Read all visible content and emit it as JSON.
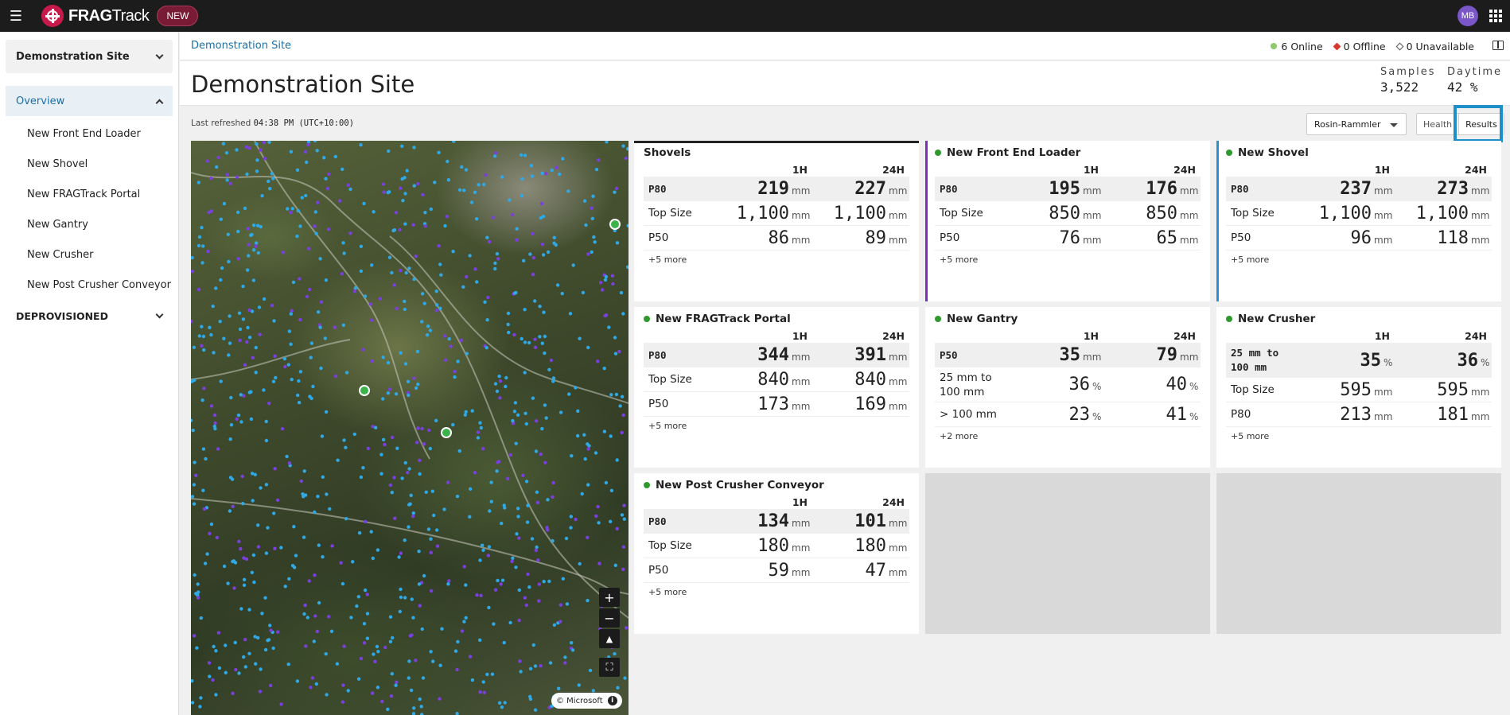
{
  "header": {
    "logo_bold": "FRAG",
    "logo_light": "Track",
    "new_badge": "NEW",
    "avatar": "MB"
  },
  "sidebar": {
    "site": "Demonstration Site",
    "overview": "Overview",
    "items": [
      "New Front End Loader",
      "New Shovel",
      "New FRAGTrack Portal",
      "New Gantry",
      "New Crusher",
      "New Post Crusher Conveyor"
    ],
    "deprovisioned": "DEPROVISIONED"
  },
  "breadcrumb": "Demonstration Site",
  "status": {
    "online": "6 Online",
    "offline": "0 Offline",
    "unavailable": "0 Unavailable"
  },
  "page_title": "Demonstration Site",
  "kpis": {
    "samples_label": "Samples",
    "samples_value": "3,522",
    "daytime_label": "Daytime",
    "daytime_value": "42 %"
  },
  "refresh": {
    "label": "Last refreshed",
    "time": "04:38 PM (UTC+10:00)"
  },
  "controls": {
    "model": "Rosin-Rammler",
    "health": "Health",
    "results": "Results"
  },
  "map": {
    "attribution": "© Microsoft",
    "zoom_in": "+",
    "zoom_out": "−"
  },
  "col_1h": "1H",
  "col_24h": "24H",
  "cards": [
    {
      "title": "Shovels",
      "rows": [
        {
          "label": "P80",
          "v1": "219",
          "u1": "mm",
          "v2": "227",
          "u2": "mm"
        },
        {
          "label": "Top Size",
          "v1": "1,100",
          "u1": "mm",
          "v2": "1,100",
          "u2": "mm"
        },
        {
          "label": "P50",
          "v1": "86",
          "u1": "mm",
          "v2": "89",
          "u2": "mm"
        }
      ],
      "more": "+5 more"
    },
    {
      "title": "New Front End Loader",
      "rows": [
        {
          "label": "P80",
          "v1": "195",
          "u1": "mm",
          "v2": "176",
          "u2": "mm"
        },
        {
          "label": "Top Size",
          "v1": "850",
          "u1": "mm",
          "v2": "850",
          "u2": "mm"
        },
        {
          "label": "P50",
          "v1": "76",
          "u1": "mm",
          "v2": "65",
          "u2": "mm"
        }
      ],
      "more": "+5 more"
    },
    {
      "title": "New Shovel",
      "rows": [
        {
          "label": "P80",
          "v1": "237",
          "u1": "mm",
          "v2": "273",
          "u2": "mm"
        },
        {
          "label": "Top Size",
          "v1": "1,100",
          "u1": "mm",
          "v2": "1,100",
          "u2": "mm"
        },
        {
          "label": "P50",
          "v1": "96",
          "u1": "mm",
          "v2": "118",
          "u2": "mm"
        }
      ],
      "more": "+5 more"
    },
    {
      "title": "New FRAGTrack Portal",
      "rows": [
        {
          "label": "P80",
          "v1": "344",
          "u1": "mm",
          "v2": "391",
          "u2": "mm"
        },
        {
          "label": "Top Size",
          "v1": "840",
          "u1": "mm",
          "v2": "840",
          "u2": "mm"
        },
        {
          "label": "P50",
          "v1": "173",
          "u1": "mm",
          "v2": "169",
          "u2": "mm"
        }
      ],
      "more": "+5 more"
    },
    {
      "title": "New Gantry",
      "rows": [
        {
          "label": "P50",
          "v1": "35",
          "u1": "mm",
          "v2": "79",
          "u2": "mm"
        },
        {
          "label": "25 mm to 100 mm",
          "v1": "36",
          "u1": "%",
          "v2": "40",
          "u2": "%"
        },
        {
          "label": "> 100 mm",
          "v1": "23",
          "u1": "%",
          "v2": "41",
          "u2": "%"
        }
      ],
      "more": "+2 more"
    },
    {
      "title": "New Crusher",
      "rows": [
        {
          "label": "25 mm to 100 mm",
          "v1": "35",
          "u1": "%",
          "v2": "36",
          "u2": "%"
        },
        {
          "label": "Top Size",
          "v1": "595",
          "u1": "mm",
          "v2": "595",
          "u2": "mm"
        },
        {
          "label": "P80",
          "v1": "213",
          "u1": "mm",
          "v2": "181",
          "u2": "mm"
        }
      ],
      "more": "+5 more"
    },
    {
      "title": "New Post Crusher Conveyor",
      "rows": [
        {
          "label": "P80",
          "v1": "134",
          "u1": "mm",
          "v2": "101",
          "u2": "mm"
        },
        {
          "label": "Top Size",
          "v1": "180",
          "u1": "mm",
          "v2": "180",
          "u2": "mm"
        },
        {
          "label": "P50",
          "v1": "59",
          "u1": "mm",
          "v2": "47",
          "u2": "mm"
        }
      ],
      "more": "+5 more"
    }
  ],
  "colors": {
    "topbar": "#1c1c1c",
    "brand": "#c8194b",
    "link": "#1d6fa5",
    "online": "#8cc96b",
    "offline": "#d9372b",
    "loader_accent": "#7b2fbf",
    "shovel_accent": "#2b8fd6",
    "results_highlight": "#1e90c9"
  }
}
